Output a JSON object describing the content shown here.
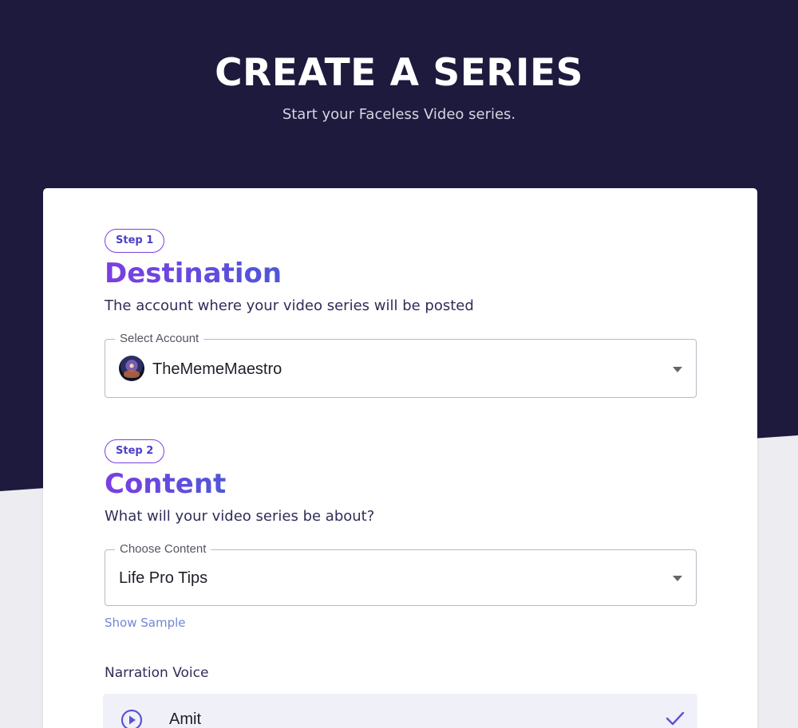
{
  "header": {
    "title": "CREATE A SERIES",
    "subtitle": "Start your Faceless Video series."
  },
  "step1": {
    "badge": "Step 1",
    "title": "Destination",
    "description": "The account where your video series will be posted",
    "select": {
      "label": "Select Account",
      "value": "TheMemeMaestro"
    }
  },
  "step2": {
    "badge": "Step 2",
    "title": "Content",
    "description": "What will your video series be about?",
    "select": {
      "label": "Choose Content",
      "value": "Life Pro Tips"
    },
    "show_sample": "Show Sample",
    "narration_label": "Narration Voice",
    "voices": [
      {
        "name": "Amit",
        "selected": true
      }
    ]
  },
  "colors": {
    "hero_bg": "#1e1a3e",
    "accent_purple": "#7a3ee2",
    "accent_blue": "#4f57d8",
    "link": "#6f86d6"
  },
  "icons": {
    "select_caret": "chevron-down-icon",
    "play": "play-circle-icon",
    "selected": "check-icon"
  }
}
